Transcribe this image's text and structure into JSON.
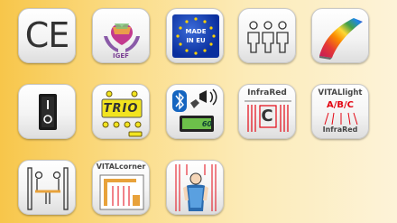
{
  "tiles": {
    "ce": {
      "text": "CE"
    },
    "iger": {
      "text": "IGEF"
    },
    "made_in_eu": {
      "line1": "MADE",
      "line2": "IN EU"
    },
    "trio": {
      "display": "TRIO"
    },
    "bluetooth": {
      "display": "60"
    },
    "infrared": {
      "title": "InfraRed",
      "letter": "C"
    },
    "vitallight": {
      "title": "VITALlight",
      "sub": "A/B/C",
      "foot": "InfraRed"
    },
    "vitalcorner": {
      "title": "VITALcorner"
    }
  },
  "colors": {
    "red": "#e30613",
    "lcd_yellow": "#f2e41f",
    "lcd_green": "#6dc04a",
    "eu_blue": "#0a2f9e",
    "star_yellow": "#ffd200"
  }
}
